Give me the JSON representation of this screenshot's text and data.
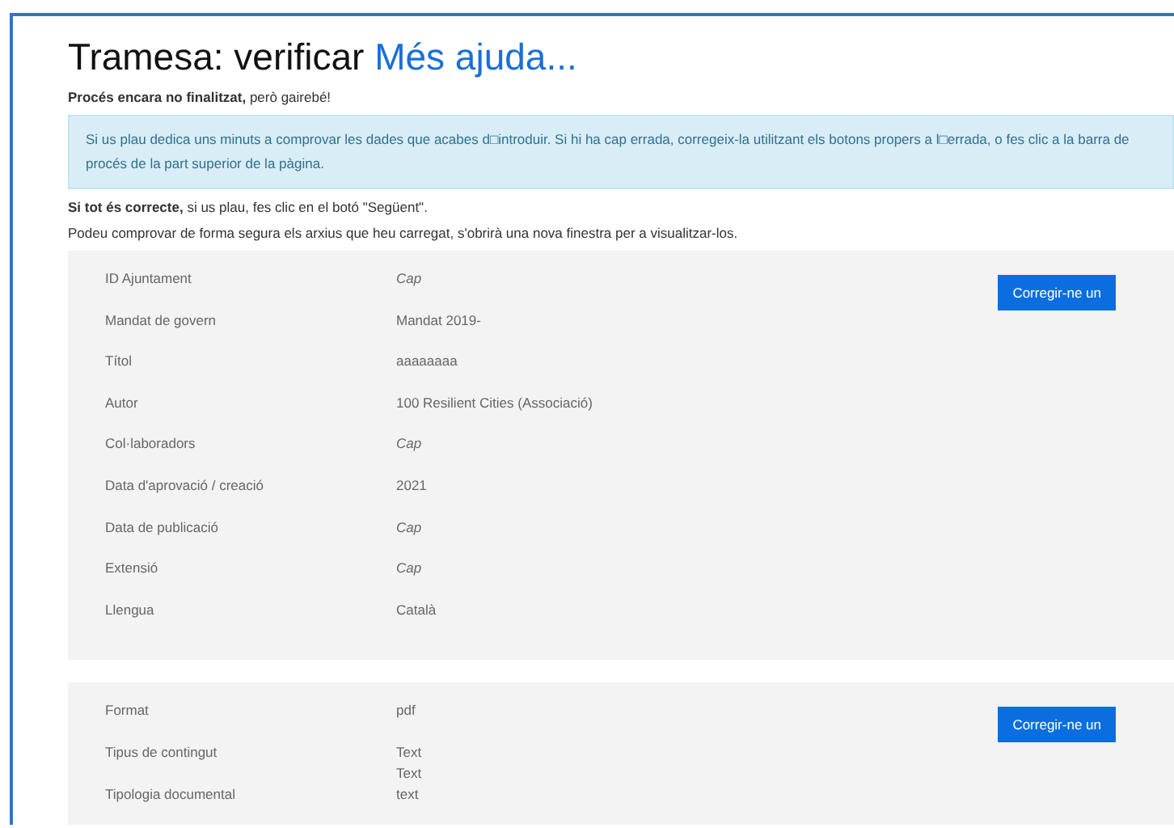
{
  "title": "Tramesa: verificar",
  "help_link": "Més ajuda...",
  "status": "**Procés encara no finalitzat,** però gairebé!",
  "info": "Si us plau dedica uns minuts a comprovar les dades que acabes d□introduir. Si hi ha cap errada, corregeix-la utilitzant els botons propers a l□errada, o fes clic a la barra de procés de la part superior de la pàgina.",
  "instruction": "**Si tot és correcte,** si us plau, fes clic en el botó \"Següent\".",
  "note": "Podeu comprovar de forma segura els arxius que heu carregat, s'obrirà una nova finestra per a visualitzar-los.",
  "sections": [
    {
      "button": "Corregir-ne un",
      "rows": [
        {
          "label": "ID Ajuntament",
          "values": [
            "Cap"
          ],
          "empty": true
        },
        {
          "label": "Mandat de govern",
          "values": [
            "Mandat 2019-"
          ],
          "empty": false
        },
        {
          "label": "Títol",
          "values": [
            "aaaaaaaa"
          ],
          "empty": false
        },
        {
          "label": "Autor",
          "values": [
            "100 Resilient Cities (Associació)"
          ],
          "empty": false
        },
        {
          "label": "Col·laboradors",
          "values": [
            "Cap"
          ],
          "empty": true
        },
        {
          "label": "Data d'aprovació / creació",
          "values": [
            "2021"
          ],
          "empty": false
        },
        {
          "label": "Data de publicació",
          "values": [
            "Cap"
          ],
          "empty": true
        },
        {
          "label": "Extensió",
          "values": [
            "Cap"
          ],
          "empty": true
        },
        {
          "label": "Llengua",
          "values": [
            "Català"
          ],
          "empty": false
        }
      ]
    },
    {
      "button": "Corregir-ne un",
      "rows": [
        {
          "label": "Format",
          "values": [
            "pdf"
          ],
          "empty": false
        },
        {
          "label": "Tipus de contingut",
          "values": [
            "Text",
            "Text"
          ],
          "empty": false
        },
        {
          "label": "Tipologia documental",
          "values": [
            "text"
          ],
          "empty": false
        }
      ]
    }
  ]
}
